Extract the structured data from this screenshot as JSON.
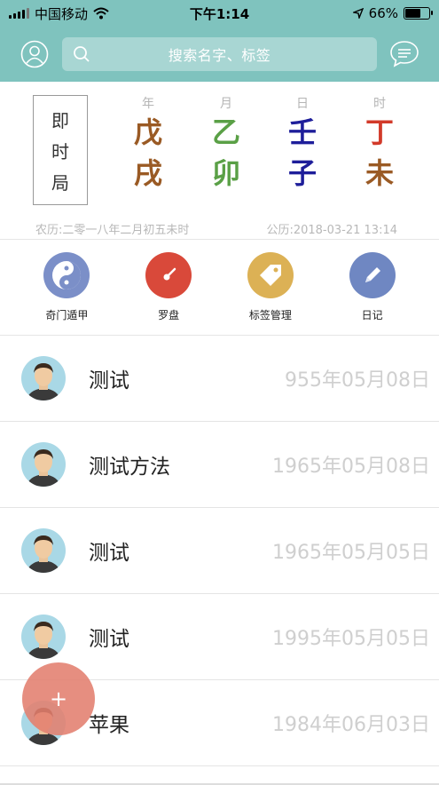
{
  "status_bar": {
    "carrier": "中国移动",
    "time": "下午1:14",
    "battery_percent": "66%",
    "battery_level": 0.66
  },
  "header": {
    "search_placeholder": "搜索名字、标签",
    "icons": [
      "user-icon",
      "search-icon",
      "message-icon"
    ]
  },
  "calendar": {
    "mode_label": [
      "即",
      "时",
      "局"
    ],
    "pillars": [
      {
        "label": "年",
        "stem": "戊",
        "branch": "戌",
        "color": "#9a5a24"
      },
      {
        "label": "月",
        "stem": "乙",
        "branch": "卯",
        "color": "#5aa046"
      },
      {
        "label": "日",
        "stem": "壬",
        "branch": "子",
        "color": "#1e1e9a"
      },
      {
        "label": "时",
        "stem": "丁",
        "branch": "未",
        "color_stem": "#d23a2a",
        "color": "#9a5a24"
      }
    ],
    "lunar": "农历:二零一八年二月初五未时",
    "solar": "公历:2018-03-21 13:14"
  },
  "shortcuts": [
    {
      "label": "奇门遁甲",
      "icon": "yin-yang-icon",
      "color": "#7b8fc8"
    },
    {
      "label": "罗盘",
      "icon": "compass-icon",
      "color": "#d9493a"
    },
    {
      "label": "标签管理",
      "icon": "tag-icon",
      "color": "#dcb155"
    },
    {
      "label": "日记",
      "icon": "pencil-icon",
      "color": "#6f87c2"
    }
  ],
  "records": [
    {
      "name": "测试",
      "date": "955年05月08日"
    },
    {
      "name": "测试方法",
      "date": "1965年05月08日"
    },
    {
      "name": "测试",
      "date": "1965年05月05日"
    },
    {
      "name": "测试",
      "date": "1995年05月05日"
    },
    {
      "name": "苹果",
      "date": "1984年06月03日"
    }
  ],
  "fab_label": "+"
}
